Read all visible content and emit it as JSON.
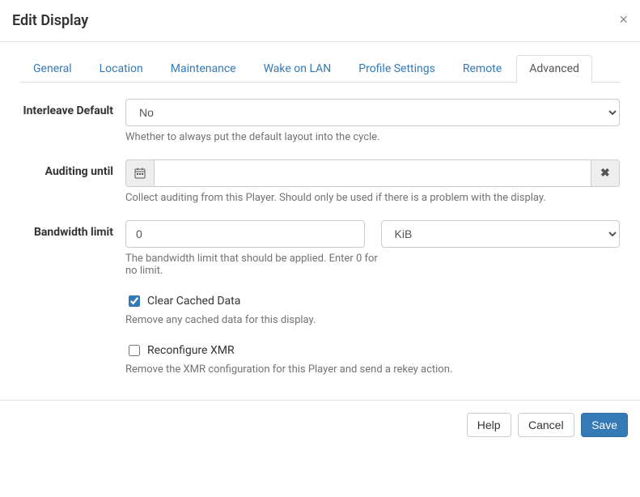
{
  "modal": {
    "title": "Edit Display"
  },
  "tabs": [
    {
      "label": "General"
    },
    {
      "label": "Location"
    },
    {
      "label": "Maintenance"
    },
    {
      "label": "Wake on LAN"
    },
    {
      "label": "Profile Settings"
    },
    {
      "label": "Remote"
    },
    {
      "label": "Advanced"
    }
  ],
  "fields": {
    "interleave": {
      "label": "Interleave Default",
      "value": "No",
      "help": "Whether to always put the default layout into the cycle."
    },
    "auditing": {
      "label": "Auditing until",
      "value": "",
      "help": "Collect auditing from this Player. Should only be used if there is a problem with the display."
    },
    "bandwidth": {
      "label": "Bandwidth limit",
      "value": "0",
      "unit": "KiB",
      "help": "The bandwidth limit that should be applied. Enter 0 for no limit."
    },
    "clearCache": {
      "label": "Clear Cached Data",
      "help": "Remove any cached data for this display."
    },
    "reconfigureXmr": {
      "label": "Reconfigure XMR",
      "help": "Remove the XMR configuration for this Player and send a rekey action."
    }
  },
  "footer": {
    "help": "Help",
    "cancel": "Cancel",
    "save": "Save"
  },
  "icons": {
    "close": "×",
    "clear": "✖"
  }
}
